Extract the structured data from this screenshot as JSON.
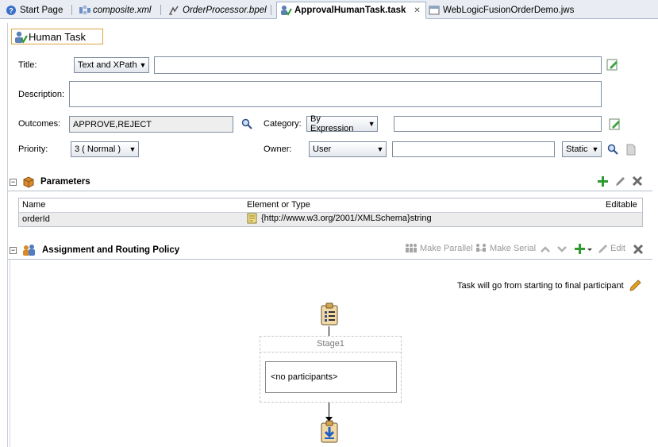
{
  "tabs": [
    {
      "label": "Start Page",
      "icon": "help-icon",
      "italic": false,
      "active": false
    },
    {
      "label": "composite.xml",
      "icon": "composite-icon",
      "italic": true,
      "active": false
    },
    {
      "label": "OrderProcessor.bpel",
      "icon": "bpel-icon",
      "italic": true,
      "active": false
    },
    {
      "label": "ApprovalHumanTask.task",
      "icon": "human-task-icon",
      "italic": false,
      "active": true
    },
    {
      "label": "WebLogicFusionOrderDemo.jws",
      "icon": "workspace-icon",
      "italic": false,
      "active": false
    }
  ],
  "editor_title": "Human Task",
  "form": {
    "title_label": "Title:",
    "title_mode": "Text and XPath",
    "title_value": "",
    "description_label": "Description:",
    "description_value": "",
    "outcomes_label": "Outcomes:",
    "outcomes_value": "APPROVE,REJECT",
    "category_label": "Category:",
    "category_mode": "By Expression",
    "category_value": "",
    "priority_label": "Priority:",
    "priority_value": "3  ( Normal )",
    "owner_label": "Owner:",
    "owner_type": "User",
    "owner_value": "",
    "owner_mode": "Static"
  },
  "parameters": {
    "heading": "Parameters",
    "columns": [
      "Name",
      "Element or Type",
      "Editable"
    ],
    "rows": [
      {
        "name": "orderId",
        "type": "{http://www.w3.org/2001/XMLSchema}string",
        "editable": ""
      }
    ]
  },
  "routing": {
    "heading": "Assignment and Routing Policy",
    "toolbar": {
      "make_parallel": "Make Parallel",
      "make_serial": "Make Serial",
      "edit": "Edit"
    },
    "flow_note": "Task will go from starting to final participant",
    "stage_name": "Stage1",
    "participants_placeholder": "<no participants>"
  },
  "colors": {
    "accent_green": "#2e9b2e",
    "delete_gray": "#6b6b6b",
    "tab_bg": "#e9edf3",
    "active_tab_border": "#9fb1c9"
  }
}
